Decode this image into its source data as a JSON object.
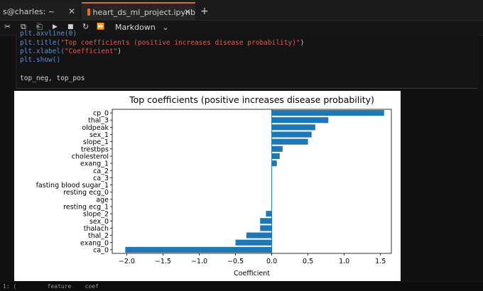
{
  "tabs": [
    {
      "label": "s@charles: ~",
      "close": "✕"
    },
    {
      "label": "heart_ds_ml_project.ipynb",
      "close": "✕"
    }
  ],
  "new_tab_label": "+",
  "toolbar": {
    "cut": "✂",
    "copy": "⧉",
    "paste": "⎗",
    "run": "▶",
    "stop": "■",
    "restart": "↻",
    "fastforward": "⏩",
    "cell_type": "Markdown",
    "cell_type_chevron": "⌄"
  },
  "code": {
    "line0": "plt.axvline(0)",
    "line1_fn": "plt.title(",
    "line1_str": "\"Top coefficients (positive increases disease probability)\"",
    "line1_end": ")",
    "line2_fn": "plt.xlabel(",
    "line2_str": "\"Coefficient\"",
    "line2_end": ")",
    "line3": "plt.show()",
    "line4": "top_neg, top_pos"
  },
  "chart_data": {
    "type": "bar",
    "orientation": "horizontal",
    "title": "Top coefficients (positive increases disease probability)",
    "xlabel": "Coefficient",
    "ylabel": "",
    "xlim": [
      -2.2,
      1.65
    ],
    "xticks": [
      "−2.0",
      "−1.5",
      "−1.0",
      "−0.5",
      "0.0",
      "0.5",
      "1.0",
      "1.5"
    ],
    "xtick_values": [
      -2.0,
      -1.5,
      -1.0,
      -0.5,
      0.0,
      0.5,
      1.0,
      1.5
    ],
    "categories": [
      "cp_0",
      "thal_3",
      "oldpeak",
      "sex_1",
      "slope_1",
      "trestbps",
      "cholesterol",
      "exang_1",
      "ca_2",
      "ca_3",
      "fasting blood sugar_1",
      "resting ecg_0",
      "age",
      "resting ecg_1",
      "slope_2",
      "sex_0",
      "thalach",
      "thal_2",
      "exang_0",
      "ca_0"
    ],
    "values": [
      1.55,
      0.78,
      0.6,
      0.55,
      0.5,
      0.15,
      0.11,
      0.07,
      0.0,
      0.0,
      0.0,
      0.0,
      0.0,
      0.0,
      -0.08,
      -0.16,
      -0.16,
      -0.35,
      -0.5,
      -2.02
    ],
    "bar_color": "#1f77b4",
    "vline": 0
  },
  "bottom_text": "1: (         feature    coef"
}
